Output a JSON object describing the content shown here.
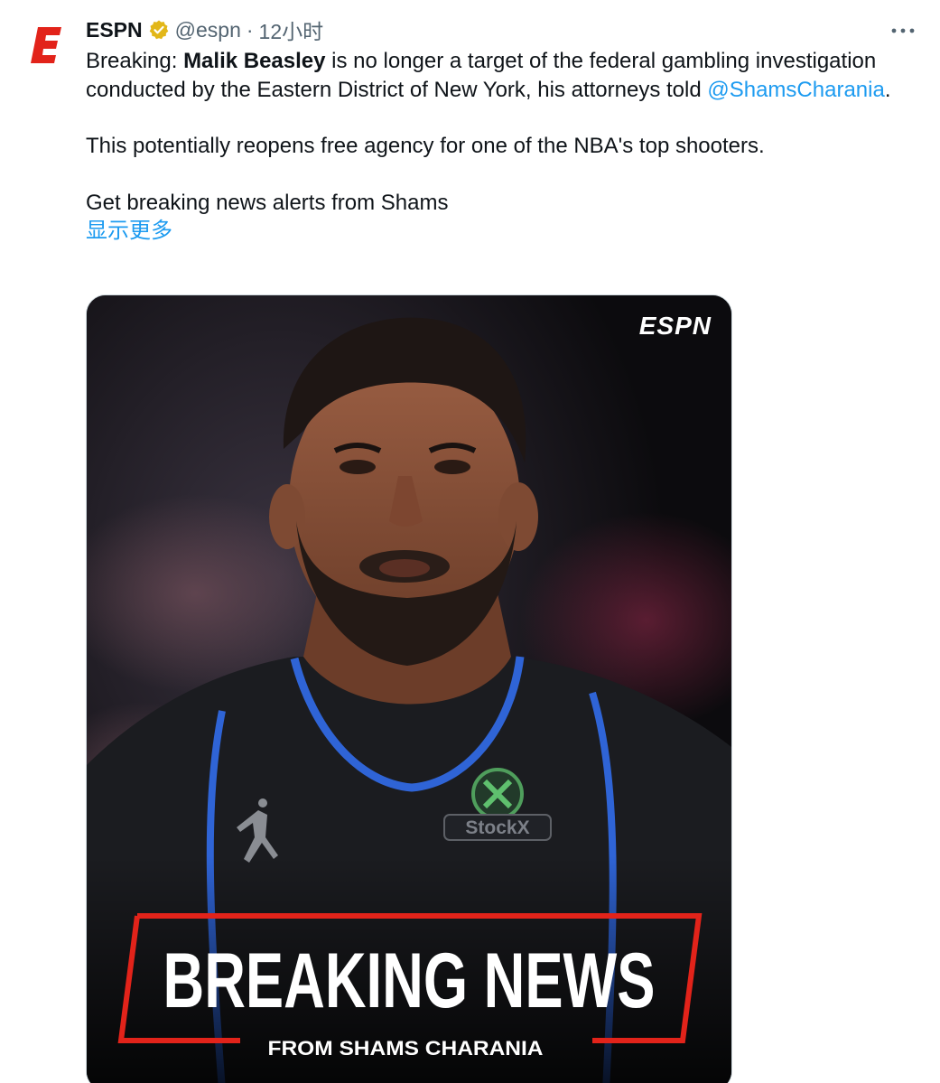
{
  "tweet": {
    "author_name": "ESPN",
    "handle": "@espn",
    "separator": "·",
    "time": "12小时",
    "text_breaking": "Breaking: ",
    "text_name": "Malik Beasley",
    "text_rest": " is no longer a target of the federal gambling investigation conducted by the Eastern District of New York, his attorneys told ",
    "mention": "@ShamsCharania",
    "text_period": ".",
    "paragraph2": "This potentially reopens free agency for one of the NBA's top shooters.",
    "paragraph3": "Get breaking news alerts from Shams",
    "show_more": "显示更多"
  },
  "media": {
    "logo": "ESPN",
    "jersey_sponsor": "StockX",
    "headline": "BREAKING NEWS",
    "subline": "FROM SHAMS CHARANIA"
  },
  "colors": {
    "espn_red": "#e2231a",
    "verified_gold": "#e2b719",
    "link_blue": "#1d9bf0",
    "secondary_text": "#536471"
  },
  "icons": {
    "avatar": "espn-logo-icon",
    "verified": "verified-badge-icon",
    "more": "more-options-icon"
  }
}
